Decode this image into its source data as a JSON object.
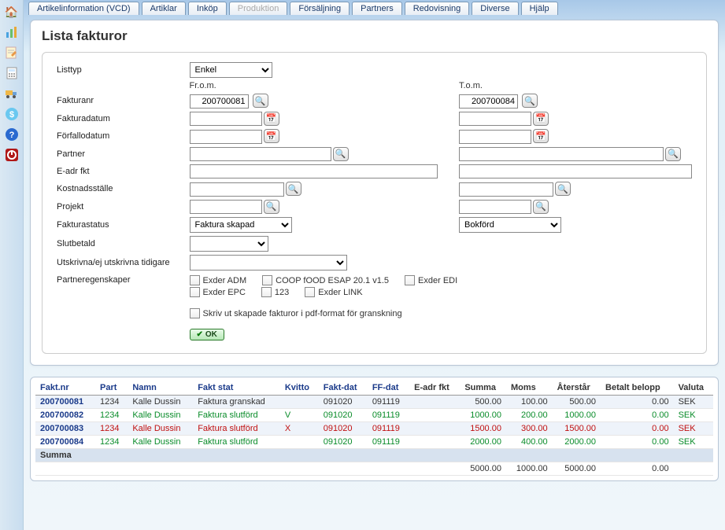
{
  "tabs": [
    "Artikelinformation (VCD)",
    "Artiklar",
    "Inköp",
    "Produktion",
    "Försäljning",
    "Partners",
    "Redovisning",
    "Diverse",
    "Hjälp"
  ],
  "tabs_disabled_index": 3,
  "page_title": "Lista fakturor",
  "labels": {
    "listtyp": "Listtyp",
    "from": "Fr.o.m.",
    "tom": "T.o.m.",
    "fakturanr": "Fakturanr",
    "fakturadatum": "Fakturadatum",
    "forfallodatum": "Förfallodatum",
    "partner": "Partner",
    "eadr": "E-adr fkt",
    "kostnadsstalle": "Kostnadsställe",
    "projekt": "Projekt",
    "fakturastatus": "Fakturastatus",
    "slutbetald": "Slutbetald",
    "utskrivna": "Utskrivna/ej utskrivna tidigare",
    "partneregenskaper": "Partneregenskaper",
    "pdf_check": "Skriv ut skapade fakturor i pdf-format för granskning",
    "ok": "OK"
  },
  "values": {
    "listtyp": "Enkel",
    "fakturanr_from": "200700081",
    "fakturanr_to": "200700084",
    "fakturastatus_from": "Faktura skapad",
    "fakturastatus_to": "Bokförd"
  },
  "partner_checks": [
    [
      "Exder ADM",
      "COOP fOOD ESAP 20.1 v1.5",
      "Exder EDI"
    ],
    [
      "Exder EPC",
      "123",
      "Exder LINK"
    ]
  ],
  "grid": {
    "headers": [
      "Fakt.nr",
      "Part",
      "Namn",
      "Fakt stat",
      "Kvitto",
      "Fakt-dat",
      "FF-dat",
      "E-adr fkt",
      "Summa",
      "Moms",
      "Återstår",
      "Betalt belopp",
      "Valuta"
    ],
    "header_plain_from": 7,
    "rows": [
      {
        "faktnr": "200700081",
        "part": "1234",
        "namn": "Kalle Dussin",
        "stat": "Faktura granskad",
        "kvitto": "",
        "faktdat": "091020",
        "ffdat": "091119",
        "eadr": "",
        "summa": "500.00",
        "moms": "100.00",
        "aterstar": "500.00",
        "betalt": "0.00",
        "valuta": "SEK",
        "color": ""
      },
      {
        "faktnr": "200700082",
        "part": "1234",
        "namn": "Kalle Dussin",
        "stat": "Faktura slutförd",
        "kvitto": "V",
        "faktdat": "091020",
        "ffdat": "091119",
        "eadr": "",
        "summa": "1000.00",
        "moms": "200.00",
        "aterstar": "1000.00",
        "betalt": "0.00",
        "valuta": "SEK",
        "color": "green"
      },
      {
        "faktnr": "200700083",
        "part": "1234",
        "namn": "Kalle Dussin",
        "stat": "Faktura slutförd",
        "kvitto": "X",
        "faktdat": "091020",
        "ffdat": "091119",
        "eadr": "",
        "summa": "1500.00",
        "moms": "300.00",
        "aterstar": "1500.00",
        "betalt": "0.00",
        "valuta": "SEK",
        "color": "red"
      },
      {
        "faktnr": "200700084",
        "part": "1234",
        "namn": "Kalle Dussin",
        "stat": "Faktura slutförd",
        "kvitto": "",
        "faktdat": "091020",
        "ffdat": "091119",
        "eadr": "",
        "summa": "2000.00",
        "moms": "400.00",
        "aterstar": "2000.00",
        "betalt": "0.00",
        "valuta": "SEK",
        "color": "green"
      }
    ],
    "sum_label": "Summa",
    "sum": {
      "summa": "5000.00",
      "moms": "1000.00",
      "aterstar": "5000.00",
      "betalt": "0.00"
    }
  }
}
